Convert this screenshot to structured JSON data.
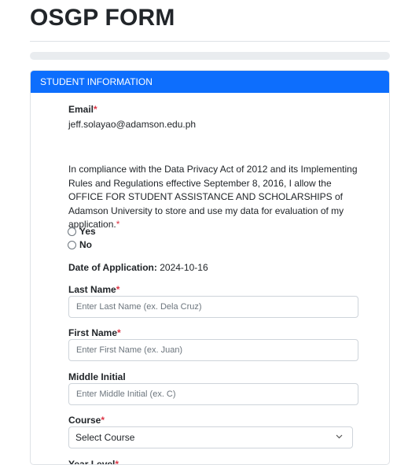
{
  "page": {
    "title": "OSGP FORM",
    "progress_percent": 0
  },
  "card": {
    "header": "STUDENT INFORMATION"
  },
  "email": {
    "label": "Email",
    "required_mark": "*",
    "value": "jeff.solayao@adamson.edu.ph"
  },
  "consent": {
    "text": "In compliance with the Data Privacy Act of 2012 and its Implementing Rules and Regulations effective September 8, 2016, I allow the OFFICE FOR STUDENT ASSISTANCE AND SCHOLARSHIPS of Adamson University to store and use my data for evaluation of my application.",
    "required_mark": "*",
    "options": [
      "Yes",
      "No"
    ]
  },
  "date_of_application": {
    "label": "Date of Application:",
    "value": "2024-10-16"
  },
  "last_name": {
    "label": "Last Name",
    "required_mark": "*",
    "placeholder": "Enter Last Name (ex. Dela Cruz)"
  },
  "first_name": {
    "label": "First Name",
    "required_mark": "*",
    "placeholder": "Enter First Name (ex. Juan)"
  },
  "middle_initial": {
    "label": "Middle Initial",
    "placeholder": "Enter Middle Initial (ex. C)"
  },
  "course": {
    "label": "Course",
    "required_mark": "*",
    "selected": "Select Course"
  },
  "year_level": {
    "label": "Year Level",
    "required_mark": "*"
  },
  "colors": {
    "primary": "#0d6efd",
    "required": "#dc3545",
    "border": "#dee2e6"
  },
  "icons": {
    "select_arrow": "chevron-down-icon"
  }
}
